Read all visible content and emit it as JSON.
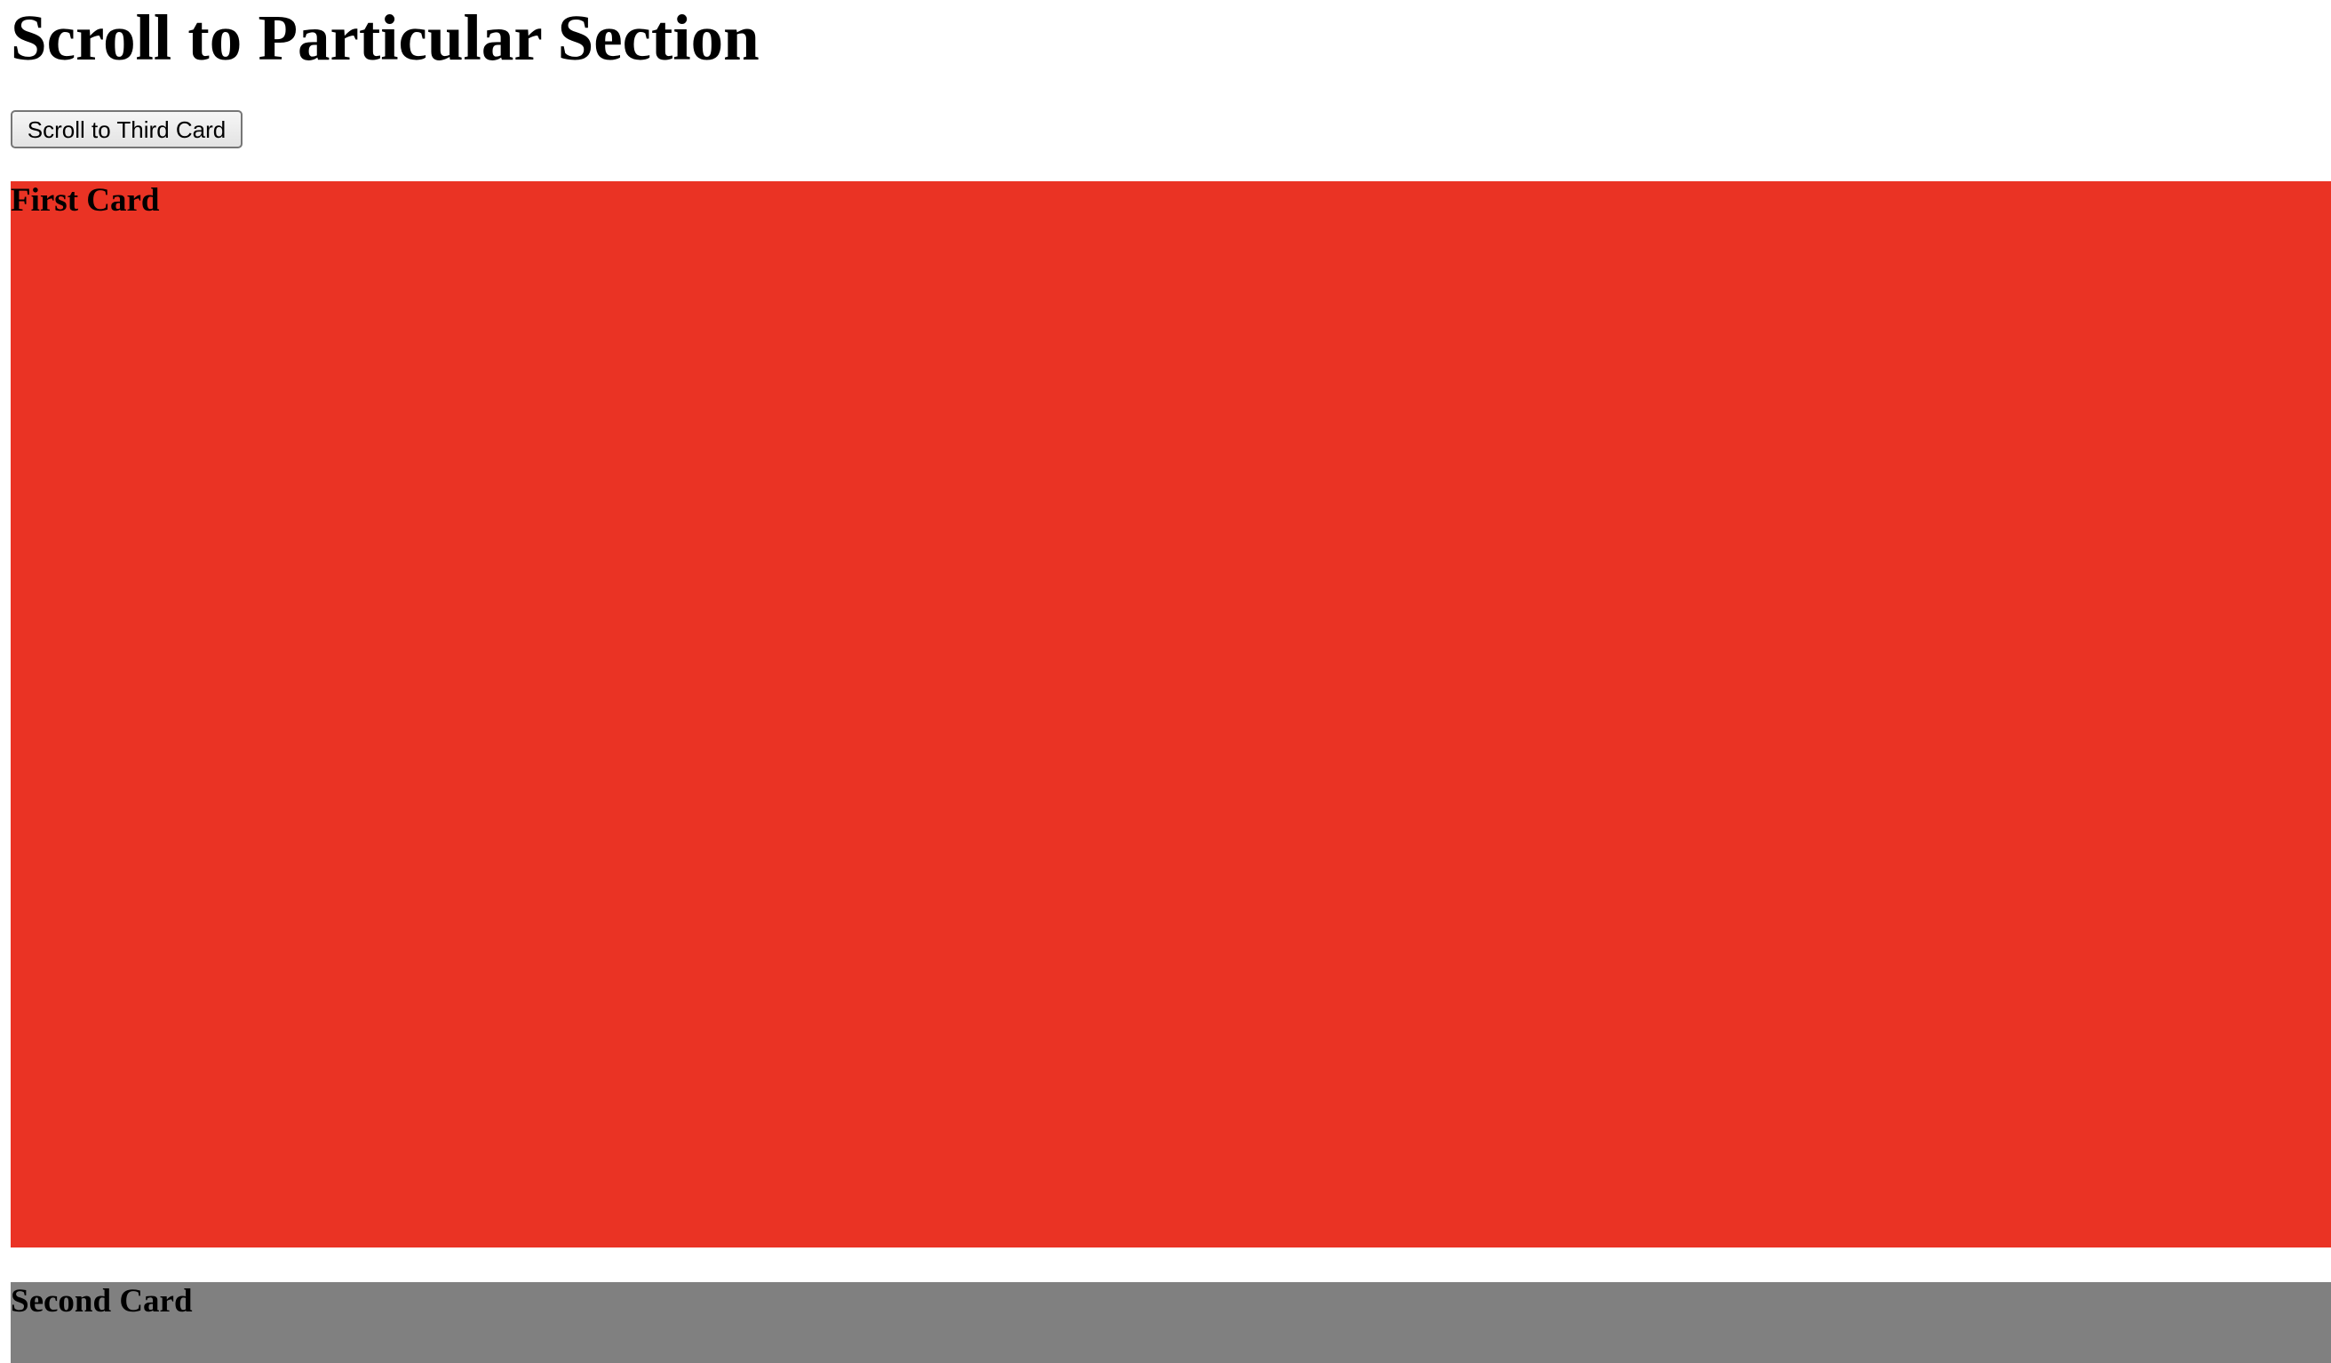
{
  "page": {
    "title": "Scroll to Particular Section"
  },
  "controls": {
    "scroll_button_label": "Scroll to Third Card"
  },
  "cards": [
    {
      "title": "First Card",
      "color": "#ea3324"
    },
    {
      "title": "Second Card",
      "color": "#808080"
    }
  ]
}
